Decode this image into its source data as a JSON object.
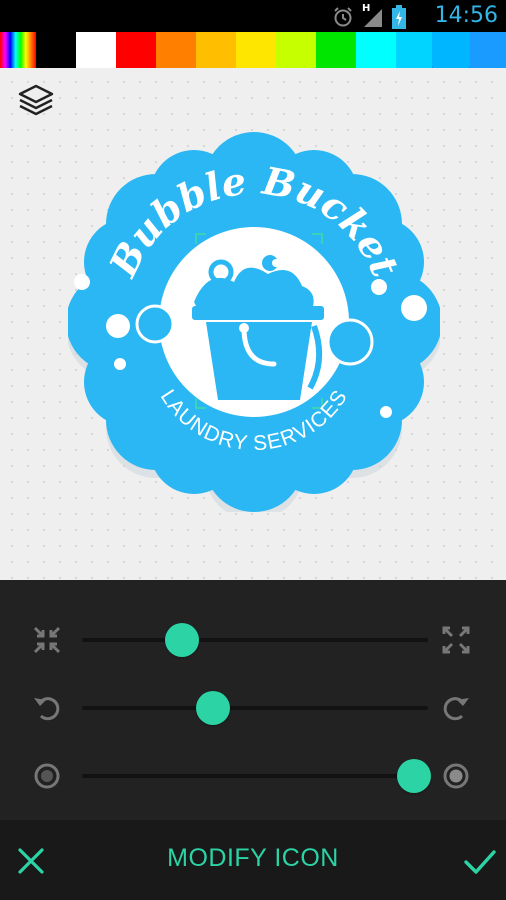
{
  "status_bar": {
    "time": "14:56",
    "icons": [
      "alarm-icon",
      "signal-icon",
      "battery-charging-icon"
    ],
    "network_type": "H"
  },
  "palette": {
    "colors": [
      "rainbow",
      "#000000",
      "#ffffff",
      "#ff0000",
      "#ff7f00",
      "#ffbf00",
      "#ffe600",
      "#c6ff00",
      "#00e600",
      "#00ffff",
      "#00d4ff",
      "#00b7ff",
      "#1a9bff"
    ],
    "selected_index": 11
  },
  "logo": {
    "title": "Bubble Bucket",
    "subtitle": "LAUNDRY SERVICES",
    "primary_color": "#2bb7f3",
    "background_color": "#ffffff"
  },
  "controls": {
    "sliders": [
      {
        "name": "size",
        "left_icon": "shrink-icon",
        "right_icon": "expand-icon",
        "value": 0.29
      },
      {
        "name": "rotation",
        "left_icon": "rotate-left-icon",
        "right_icon": "rotate-right-icon",
        "value": 0.38
      },
      {
        "name": "opacity",
        "left_icon": "circle-outline-icon",
        "right_icon": "circle-filled-icon",
        "value": 0.96
      }
    ]
  },
  "bottom_bar": {
    "title": "MODIFY ICON",
    "cancel_icon": "close-icon",
    "confirm_icon": "check-icon",
    "accent": "#2bd3a5"
  }
}
